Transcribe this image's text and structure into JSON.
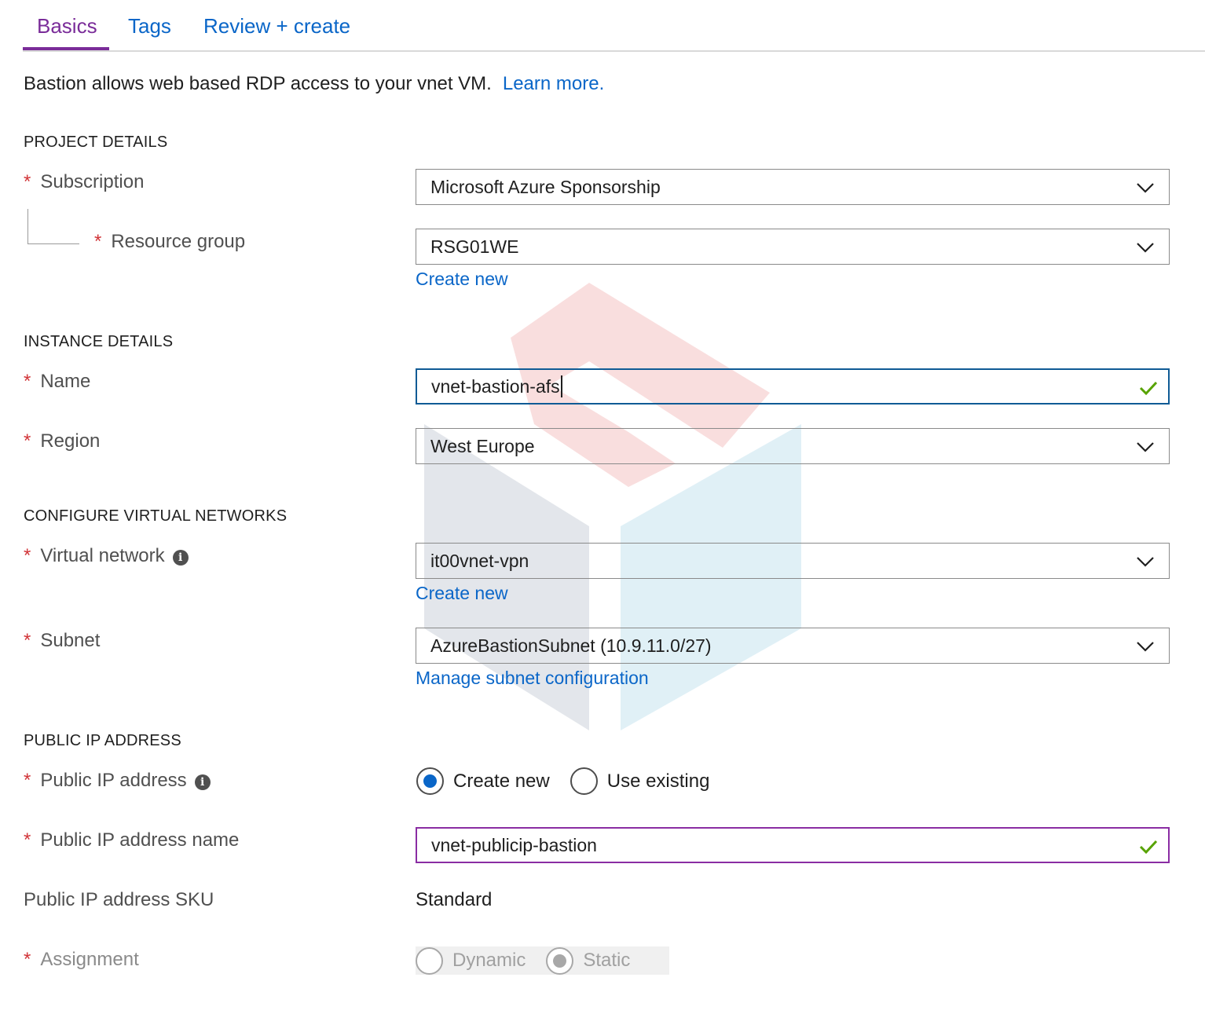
{
  "tabs": [
    {
      "label": "Basics",
      "active": true
    },
    {
      "label": "Tags",
      "active": false
    },
    {
      "label": "Review + create",
      "active": false
    }
  ],
  "intro": {
    "text": "Bastion allows web based RDP access to your vnet VM.",
    "link": "Learn more."
  },
  "sections": {
    "project": "PROJECT DETAILS",
    "instance": "INSTANCE DETAILS",
    "vnet": "CONFIGURE VIRTUAL NETWORKS",
    "publicip": "PUBLIC IP ADDRESS"
  },
  "fields": {
    "subscription": {
      "label": "Subscription",
      "value": "Microsoft Azure Sponsorship"
    },
    "resource_group": {
      "label": "Resource group",
      "value": "RSG01WE",
      "create_new": "Create new"
    },
    "name": {
      "label": "Name",
      "value": "vnet-bastion-afs"
    },
    "region": {
      "label": "Region",
      "value": "West Europe"
    },
    "virtual_network": {
      "label": "Virtual network",
      "value": "it00vnet-vpn",
      "create_new": "Create new"
    },
    "subnet": {
      "label": "Subnet",
      "value": "AzureBastionSubnet (10.9.11.0/27)",
      "manage": "Manage subnet configuration"
    },
    "public_ip": {
      "label": "Public IP address",
      "options": [
        "Create new",
        "Use existing"
      ],
      "selected": "Create new"
    },
    "public_ip_name": {
      "label": "Public IP address name",
      "value": "vnet-publicip-bastion"
    },
    "public_ip_sku": {
      "label": "Public IP address SKU",
      "value": "Standard"
    },
    "assignment": {
      "label": "Assignment",
      "options": [
        "Dynamic",
        "Static"
      ],
      "selected": "Static",
      "disabled": true
    }
  },
  "colors": {
    "accent_purple": "#7a2c99",
    "link_blue": "#0a66c8",
    "required_red": "#d13438",
    "valid_green": "#57a300",
    "focus_border": "#0f5b95"
  },
  "icons": {
    "dropdown": "chevron-down-icon",
    "valid": "checkmark-icon",
    "info": "info-icon"
  }
}
